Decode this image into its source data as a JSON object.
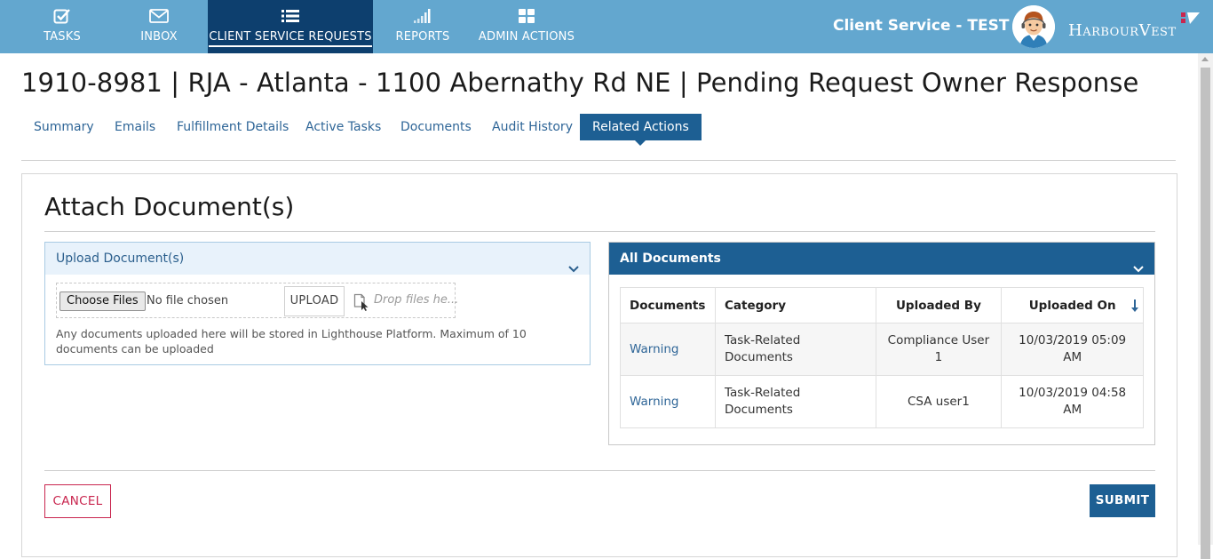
{
  "nav": {
    "items": [
      {
        "label": "TASKS",
        "icon": "check-square-icon"
      },
      {
        "label": "INBOX",
        "icon": "envelope-icon"
      },
      {
        "label": "CLIENT SERVICE REQUESTS",
        "icon": "list-icon",
        "active": true
      },
      {
        "label": "REPORTS",
        "icon": "signal-bars-icon"
      },
      {
        "label": "ADMIN ACTIONS",
        "icon": "grid-icon"
      }
    ],
    "environment": "Client Service - TEST",
    "logo_text": "HarbourVest"
  },
  "page": {
    "title": "1910-8981 | RJA - Atlanta - 1100 Abernathy Rd NE | Pending Request Owner Response"
  },
  "tabs": [
    {
      "label": "Summary"
    },
    {
      "label": "Emails"
    },
    {
      "label": "Fulfillment Details"
    },
    {
      "label": "Active Tasks"
    },
    {
      "label": "Documents"
    },
    {
      "label": "Audit History"
    },
    {
      "label": "Related Actions",
      "active": true
    }
  ],
  "attach": {
    "title": "Attach Document(s)",
    "upload_panel": {
      "title": "Upload Document(s)",
      "choose_label": "Choose Files",
      "no_file": "No file chosen",
      "upload_label": "UPLOAD",
      "drop_text": "Drop files he...",
      "note": "Any documents uploaded here will be stored in Lighthouse Platform. Maximum of 10 documents can be uploaded"
    },
    "all_documents": {
      "title": "All Documents",
      "columns": [
        "Documents",
        "Category",
        "Uploaded By",
        "Uploaded On"
      ],
      "rows": [
        {
          "document": "Warning",
          "category": "Task-Related Documents",
          "uploaded_by": "Compliance User 1",
          "uploaded_on": "10/03/2019 05:09 AM"
        },
        {
          "document": "Warning",
          "category": "Task-Related Documents",
          "uploaded_by": "CSA user1",
          "uploaded_on": "10/03/2019 04:58 AM"
        }
      ]
    },
    "cancel_label": "CANCEL",
    "submit_label": "SUBMIT"
  },
  "colors": {
    "topbar": "#63a7cf",
    "nav_active": "#0d3f6e",
    "primary": "#1d5f93",
    "link": "#2e6597",
    "cancel": "#c9264f"
  }
}
